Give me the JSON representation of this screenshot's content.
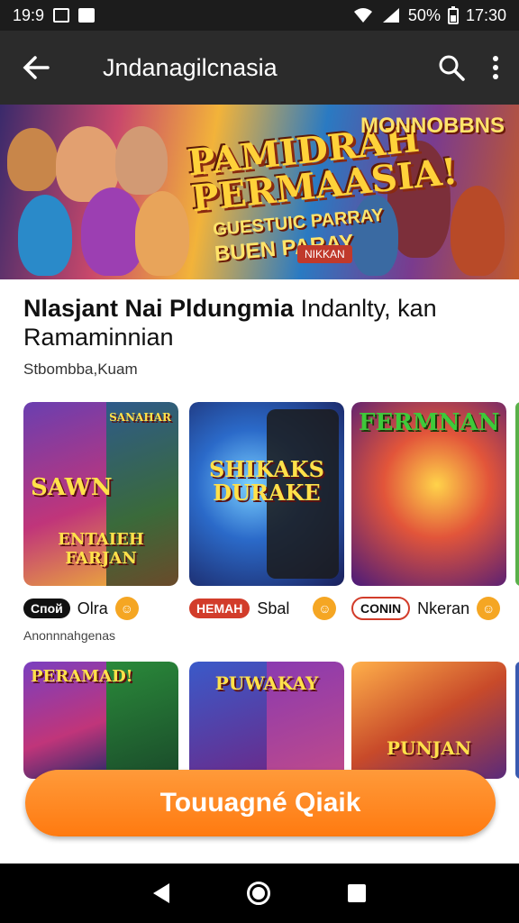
{
  "status_bar": {
    "left_time": "19:9",
    "battery": "50%",
    "clock": "17:30"
  },
  "app_bar": {
    "title": "Jndanagilcnasia"
  },
  "banner": {
    "main_title": "PAMIDRAH\nPERMAASIA!",
    "subtitle_top": "GUESTUIC PARRAY",
    "subtitle_bottom": "BUEN PARAY",
    "right_title": "MONNOBBNS",
    "tag": "NIKKAN"
  },
  "heading": {
    "bold_part": "Nlasjant Nai Pldungmia",
    "regular_part": " Indanlty, kan Ramaminnian"
  },
  "subheading": "Stbombba,Kuam",
  "cards_row1": [
    {
      "title_top": "SANAHAR",
      "title_mid": "SAWN",
      "title_bottom": "ENTAIEH FARJAN",
      "pill": "Спой",
      "pill_style": "dark",
      "label": "Olra",
      "coin": "☺"
    },
    {
      "title_top": "",
      "title_mid": "SHIKAKS\nDURAKE",
      "title_bottom": "",
      "pill": "НЕМАН",
      "pill_style": "red",
      "label": "Sbal",
      "coin": "☺"
    },
    {
      "title_top": "FERMNAN",
      "title_mid": "",
      "title_bottom": "",
      "pill": "CONIN",
      "pill_style": "outline",
      "label": "Nkeran",
      "coin": "☺"
    }
  ],
  "row1_caption": "Anonnnahgenas",
  "cards_row2": [
    {
      "title": "PERAMAD!"
    },
    {
      "title": "PUWAKAY"
    },
    {
      "title": "PUNJAN"
    }
  ],
  "cta": {
    "label": "Touuagné Qiaik"
  },
  "colors": {
    "accent": "#ff7a10",
    "appbar": "#2b2b2b",
    "statusbar": "#1c1c1c"
  }
}
